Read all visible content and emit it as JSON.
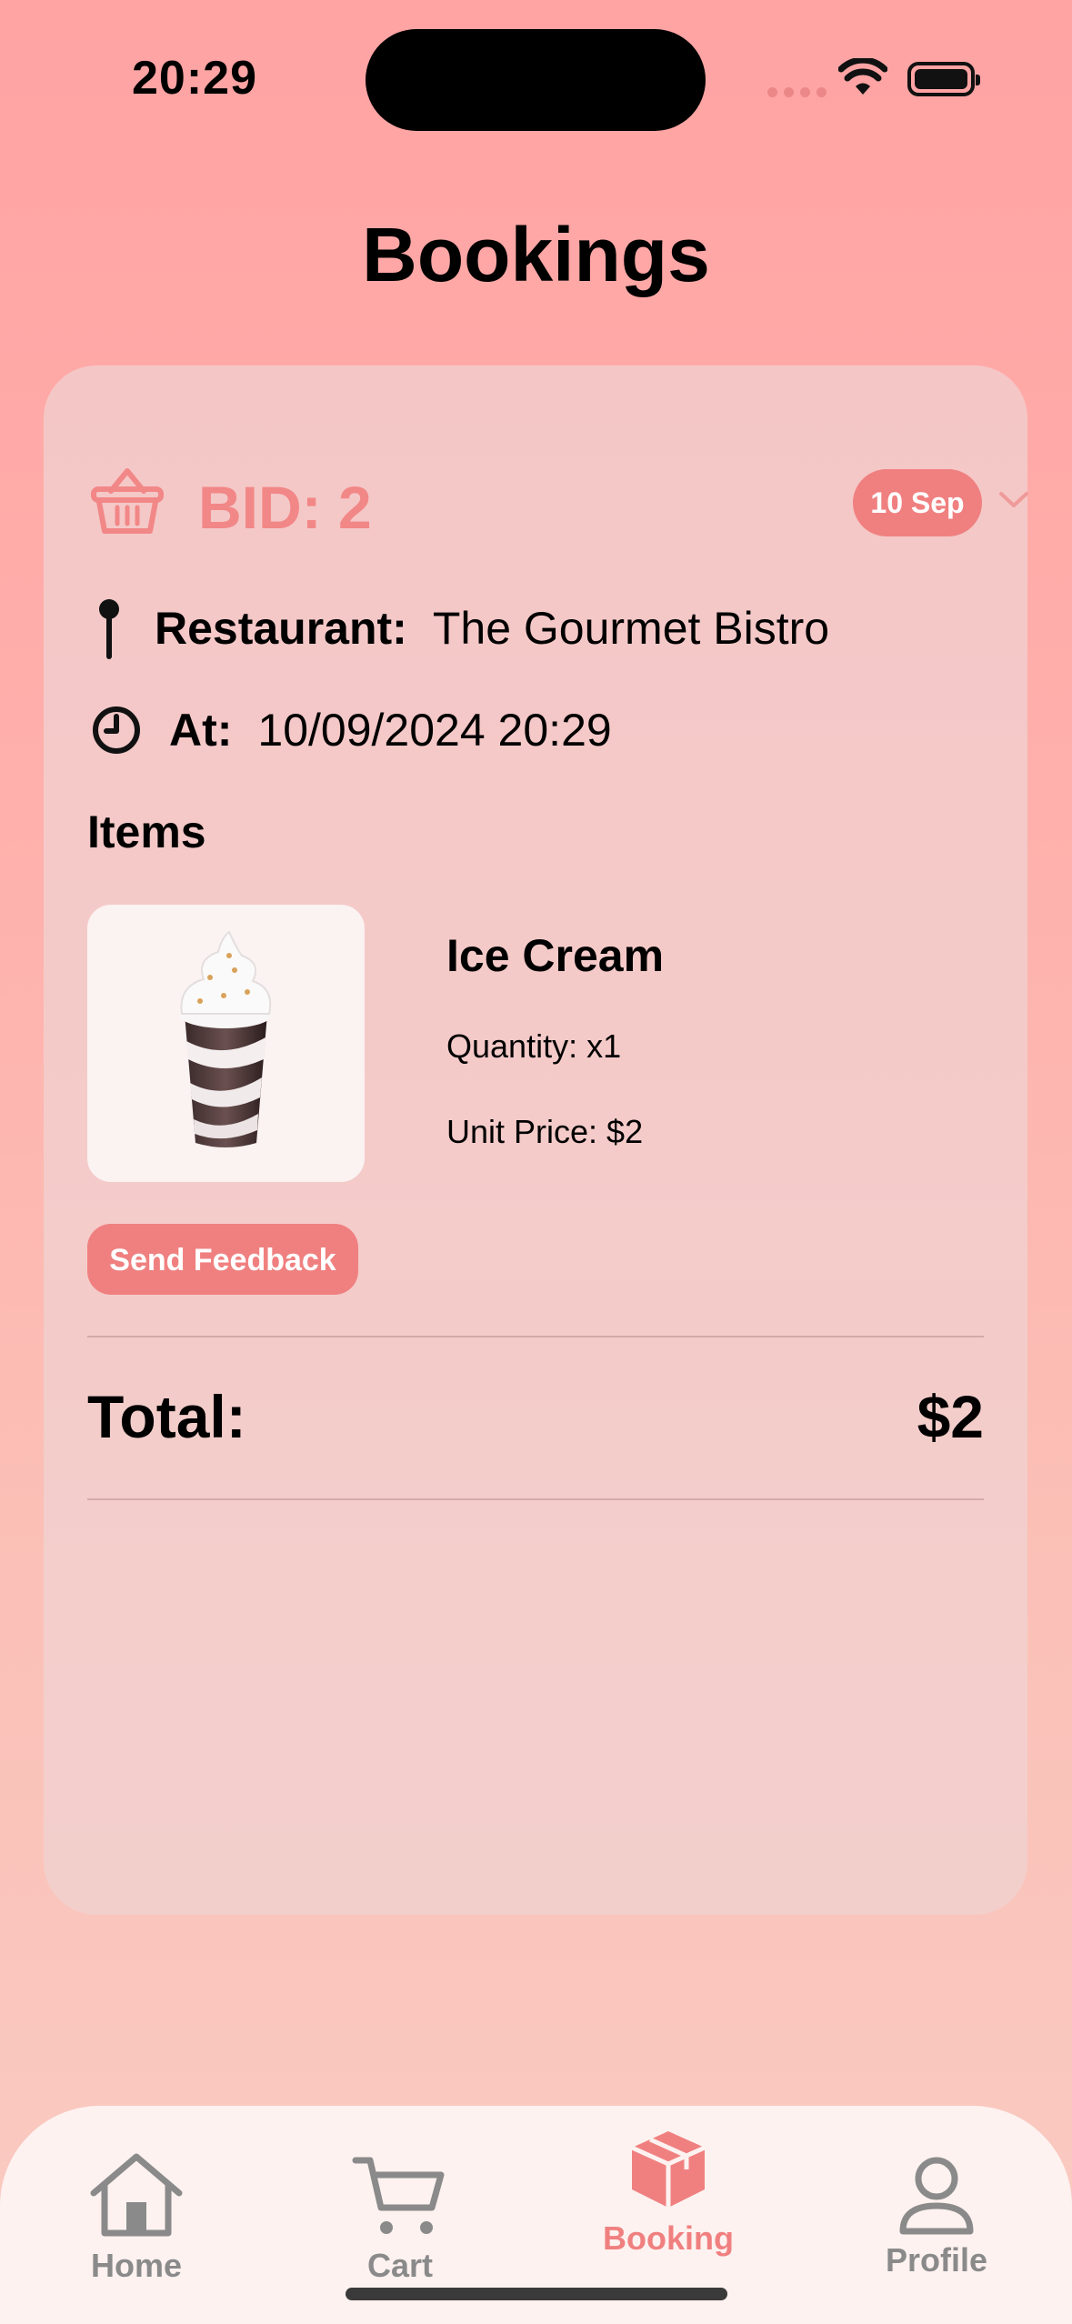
{
  "status_bar": {
    "time": "20:29"
  },
  "page": {
    "title": "Bookings"
  },
  "booking": {
    "bid": "BID: 2",
    "date_pill": "10 Sep",
    "restaurant_label": "Restaurant:",
    "restaurant_value": "The Gourmet Bistro",
    "at_label": "At:",
    "at_value": "10/09/2024 20:29",
    "items_heading": "Items",
    "items": [
      {
        "name": "Ice Cream",
        "quantity": "Quantity: x1",
        "unit_price": "Unit Price: $2"
      }
    ],
    "feedback_label": "Send Feedback",
    "total_label": "Total:",
    "total_value": "$2"
  },
  "tabbar": {
    "tabs": [
      {
        "label": "Home",
        "icon": "home-icon"
      },
      {
        "label": "Cart",
        "icon": "cart-icon"
      },
      {
        "label": "Booking",
        "icon": "box-icon",
        "active": true
      },
      {
        "label": "Profile",
        "icon": "person-icon"
      }
    ]
  },
  "colors": {
    "accent": "#f08080",
    "inactive": "#8a8a8a"
  }
}
